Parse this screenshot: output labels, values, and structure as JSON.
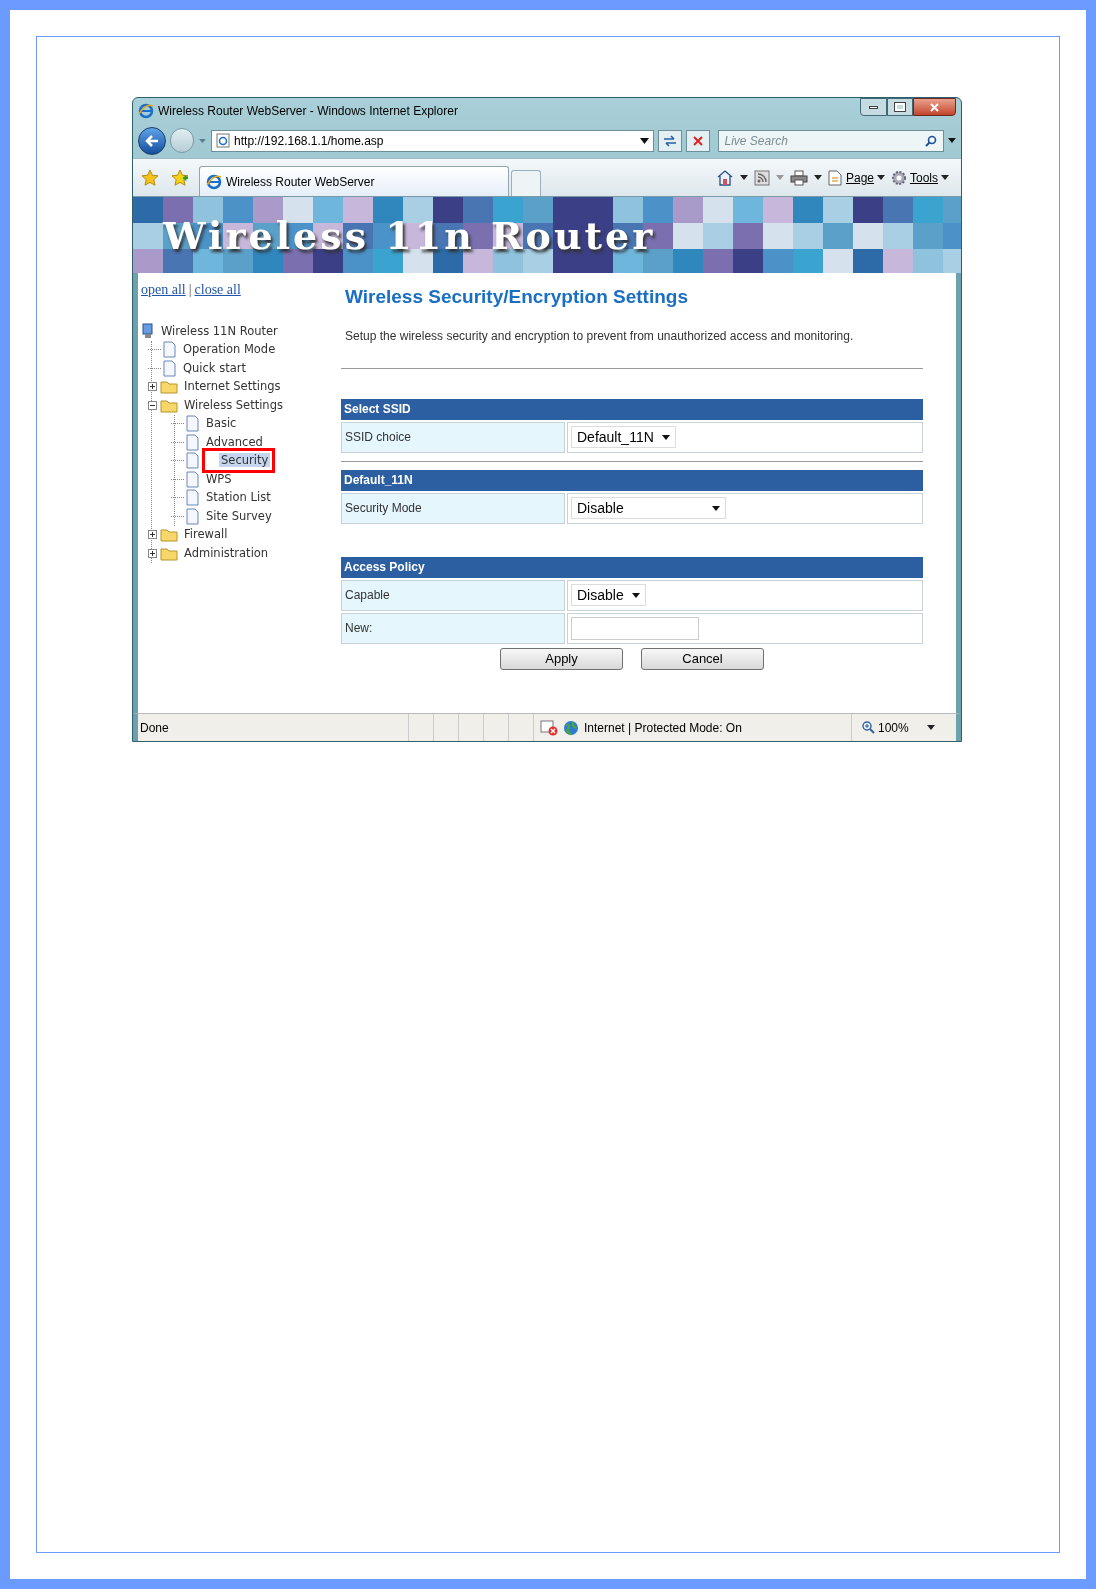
{
  "window": {
    "title": "Wireless Router WebServer - Windows Internet Explorer"
  },
  "address_bar": {
    "url": "http://192.168.1.1/home.asp"
  },
  "search": {
    "placeholder": "Live Search"
  },
  "tab": {
    "title": "Wireless Router WebServer"
  },
  "command_bar": [
    "Page",
    "Tools"
  ],
  "banner": {
    "title": "Wireless 11n Router"
  },
  "nav_links": [
    "open all",
    "|",
    "close all"
  ],
  "tree": [
    {
      "label": "Wireless 11N Router",
      "kind": "root",
      "selected": false,
      "annotated": false,
      "children": [
        {
          "label": "Operation Mode",
          "kind": "page",
          "selected": false,
          "annotated": false
        },
        {
          "label": "Quick start",
          "kind": "page",
          "selected": false,
          "annotated": false
        },
        {
          "label": "Internet Settings",
          "kind": "folder",
          "expanded": false,
          "selected": false,
          "annotated": false
        },
        {
          "label": "Wireless Settings",
          "kind": "folder",
          "expanded": true,
          "selected": false,
          "annotated": false,
          "children": [
            {
              "label": "Basic",
              "kind": "page",
              "selected": false,
              "annotated": false
            },
            {
              "label": "Advanced",
              "kind": "page",
              "selected": false,
              "annotated": false
            },
            {
              "label": "Security",
              "kind": "page",
              "selected": true,
              "annotated": true
            },
            {
              "label": "WPS",
              "kind": "page",
              "selected": false,
              "annotated": false
            },
            {
              "label": "Station List",
              "kind": "page",
              "selected": false,
              "annotated": false
            },
            {
              "label": "Site Survey",
              "kind": "page",
              "selected": false,
              "annotated": false
            }
          ]
        },
        {
          "label": "Firewall",
          "kind": "folder",
          "expanded": false,
          "selected": false,
          "annotated": false
        },
        {
          "label": "Administration",
          "kind": "folder",
          "expanded": false,
          "selected": false,
          "annotated": false
        }
      ]
    }
  ],
  "page": {
    "heading": "Wireless Security/Encryption Settings",
    "description": "Setup the wireless security and encryption to prevent from unauthorized access and monitoring.",
    "sections": [
      {
        "title": "Select SSID",
        "rule_after": true,
        "rows": [
          {
            "label": "SSID choice",
            "kind": "select",
            "value": "Default_11N"
          }
        ]
      },
      {
        "title": "Default_11N",
        "rule_after": false,
        "rows": [
          {
            "label": "Security Mode",
            "kind": "select",
            "value": "Disable"
          }
        ]
      },
      {
        "title": "Access Policy",
        "rule_after": false,
        "rows": [
          {
            "label": "Capable",
            "kind": "select",
            "value": "Disable"
          },
          {
            "label": "New:",
            "kind": "text"
          }
        ]
      }
    ],
    "buttons": [
      "Apply",
      "Cancel"
    ]
  },
  "status_bar": {
    "status": "Done",
    "zone": "Internet | Protected Mode: On",
    "zoom": "100%"
  }
}
